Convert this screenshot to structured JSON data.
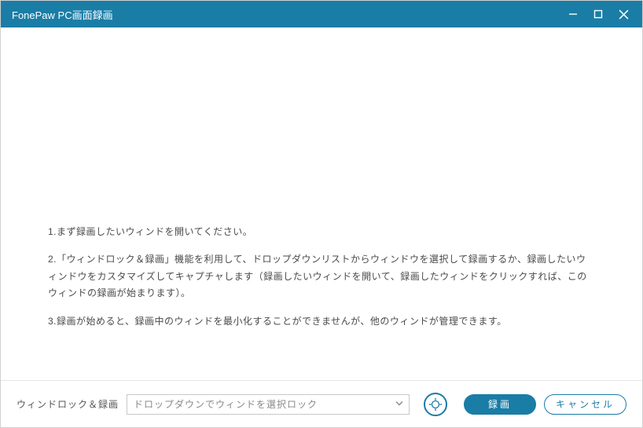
{
  "titlebar": {
    "title": "FonePaw PC画面録画"
  },
  "content": {
    "step1": "1.まず録画したいウィンドを開いてください。",
    "step2": "2.「ウィンドロック＆録画」機能を利用して、ドロップダウンリストからウィンドウを選択して録画するか、録画したいウィンドウをカスタマイズしてキャプチャします（録画したいウィンドを開いて、録画したウィンドをクリックすれば、このウィンドの録画が始まります）。",
    "step3": "3.録画が始めると、録画中のウィンドを最小化することができませんが、他のウィンドが管理できます。"
  },
  "footer": {
    "label": "ウィンドロック＆録画",
    "dropdown_placeholder": "ドロップダウンでウィンドを選択ロック",
    "record_label": "録画",
    "cancel_label": "キャンセル"
  }
}
